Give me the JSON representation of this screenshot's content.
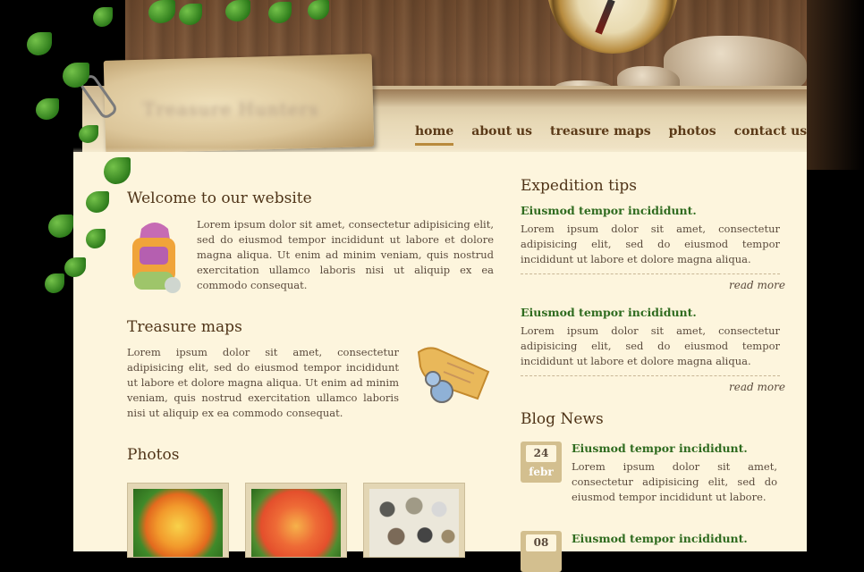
{
  "site": {
    "logo_text": "Treasure Hunters"
  },
  "nav": {
    "items": [
      {
        "label": "home",
        "active": true
      },
      {
        "label": "about us",
        "active": false
      },
      {
        "label": "treasure maps",
        "active": false
      },
      {
        "label": "photos",
        "active": false
      },
      {
        "label": "contact us",
        "active": false
      }
    ]
  },
  "welcome": {
    "title": "Welcome to our website",
    "body": "Lorem ipsum dolor sit amet, consectetur adipisicing elit, sed do eiusmod tempor incididunt ut labore et dolore magna aliqua. Ut enim ad minim veniam, quis nostrud exercitation ullamco laboris nisi ut aliquip ex ea commodo consequat."
  },
  "treasure": {
    "title": "Treasure maps",
    "body": "Lorem ipsum dolor sit amet, consectetur adipisicing elit, sed do eiusmod tempor incididunt ut labore et dolore magna aliqua. Ut enim ad minim veniam, quis nostrud exercitation ullamco laboris nisi ut aliquip ex ea commodo consequat."
  },
  "photos": {
    "title": "Photos"
  },
  "expedition": {
    "title": "Expedition tips",
    "tips": [
      {
        "heading": "Eiusmod tempor incididunt.",
        "body": "Lorem ipsum dolor sit amet, consectetur adipisicing elit, sed do eiusmod tempor incididunt ut labore et dolore magna aliqua.",
        "read_more": "read more"
      },
      {
        "heading": "Eiusmod tempor incididunt.",
        "body": "Lorem ipsum dolor sit amet, consectetur adipisicing elit, sed do eiusmod tempor incididunt ut labore et dolore magna aliqua.",
        "read_more": "read more"
      }
    ]
  },
  "blog": {
    "title": "Blog News",
    "posts": [
      {
        "day": "24",
        "month": "febr",
        "heading": "Eiusmod tempor incididunt.",
        "body": "Lorem ipsum dolor sit amet, consectetur adipisicing elit, sed do eiusmod tempor incididunt ut labore."
      },
      {
        "day": "08",
        "month": "",
        "heading": "Eiusmod tempor incididunt.",
        "body": ""
      }
    ]
  },
  "colors": {
    "content_bg": "#fdf5dd",
    "heading": "#4f3418",
    "green_link": "#2f6b1f",
    "nav_text": "#5b3a18",
    "nav_active_underline": "#b98a3c"
  }
}
